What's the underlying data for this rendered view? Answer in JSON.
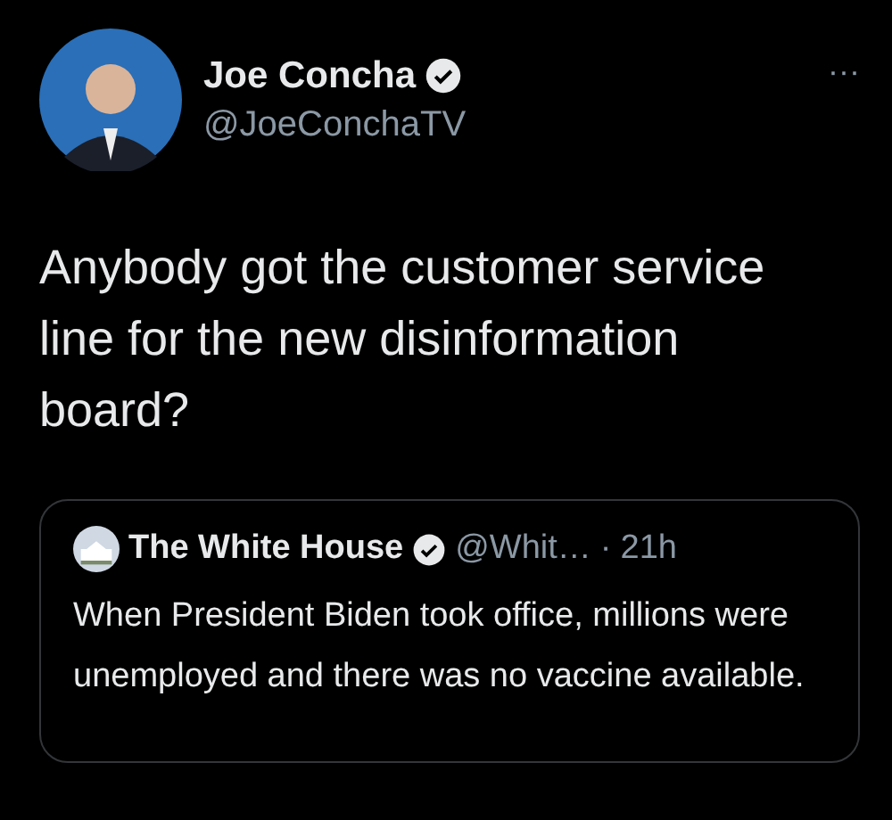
{
  "author": {
    "name": "Joe Concha",
    "verified": true,
    "handle": "@JoeConchaTV"
  },
  "more": "···",
  "text": "Anybody got the customer service line for the new disinformation board?",
  "quote": {
    "name": "The White House",
    "verified": true,
    "handle": "@Whit…",
    "separator": "·",
    "time": "21h",
    "text": "When President Biden took office, millions were unemployed and there was no vaccine available."
  }
}
